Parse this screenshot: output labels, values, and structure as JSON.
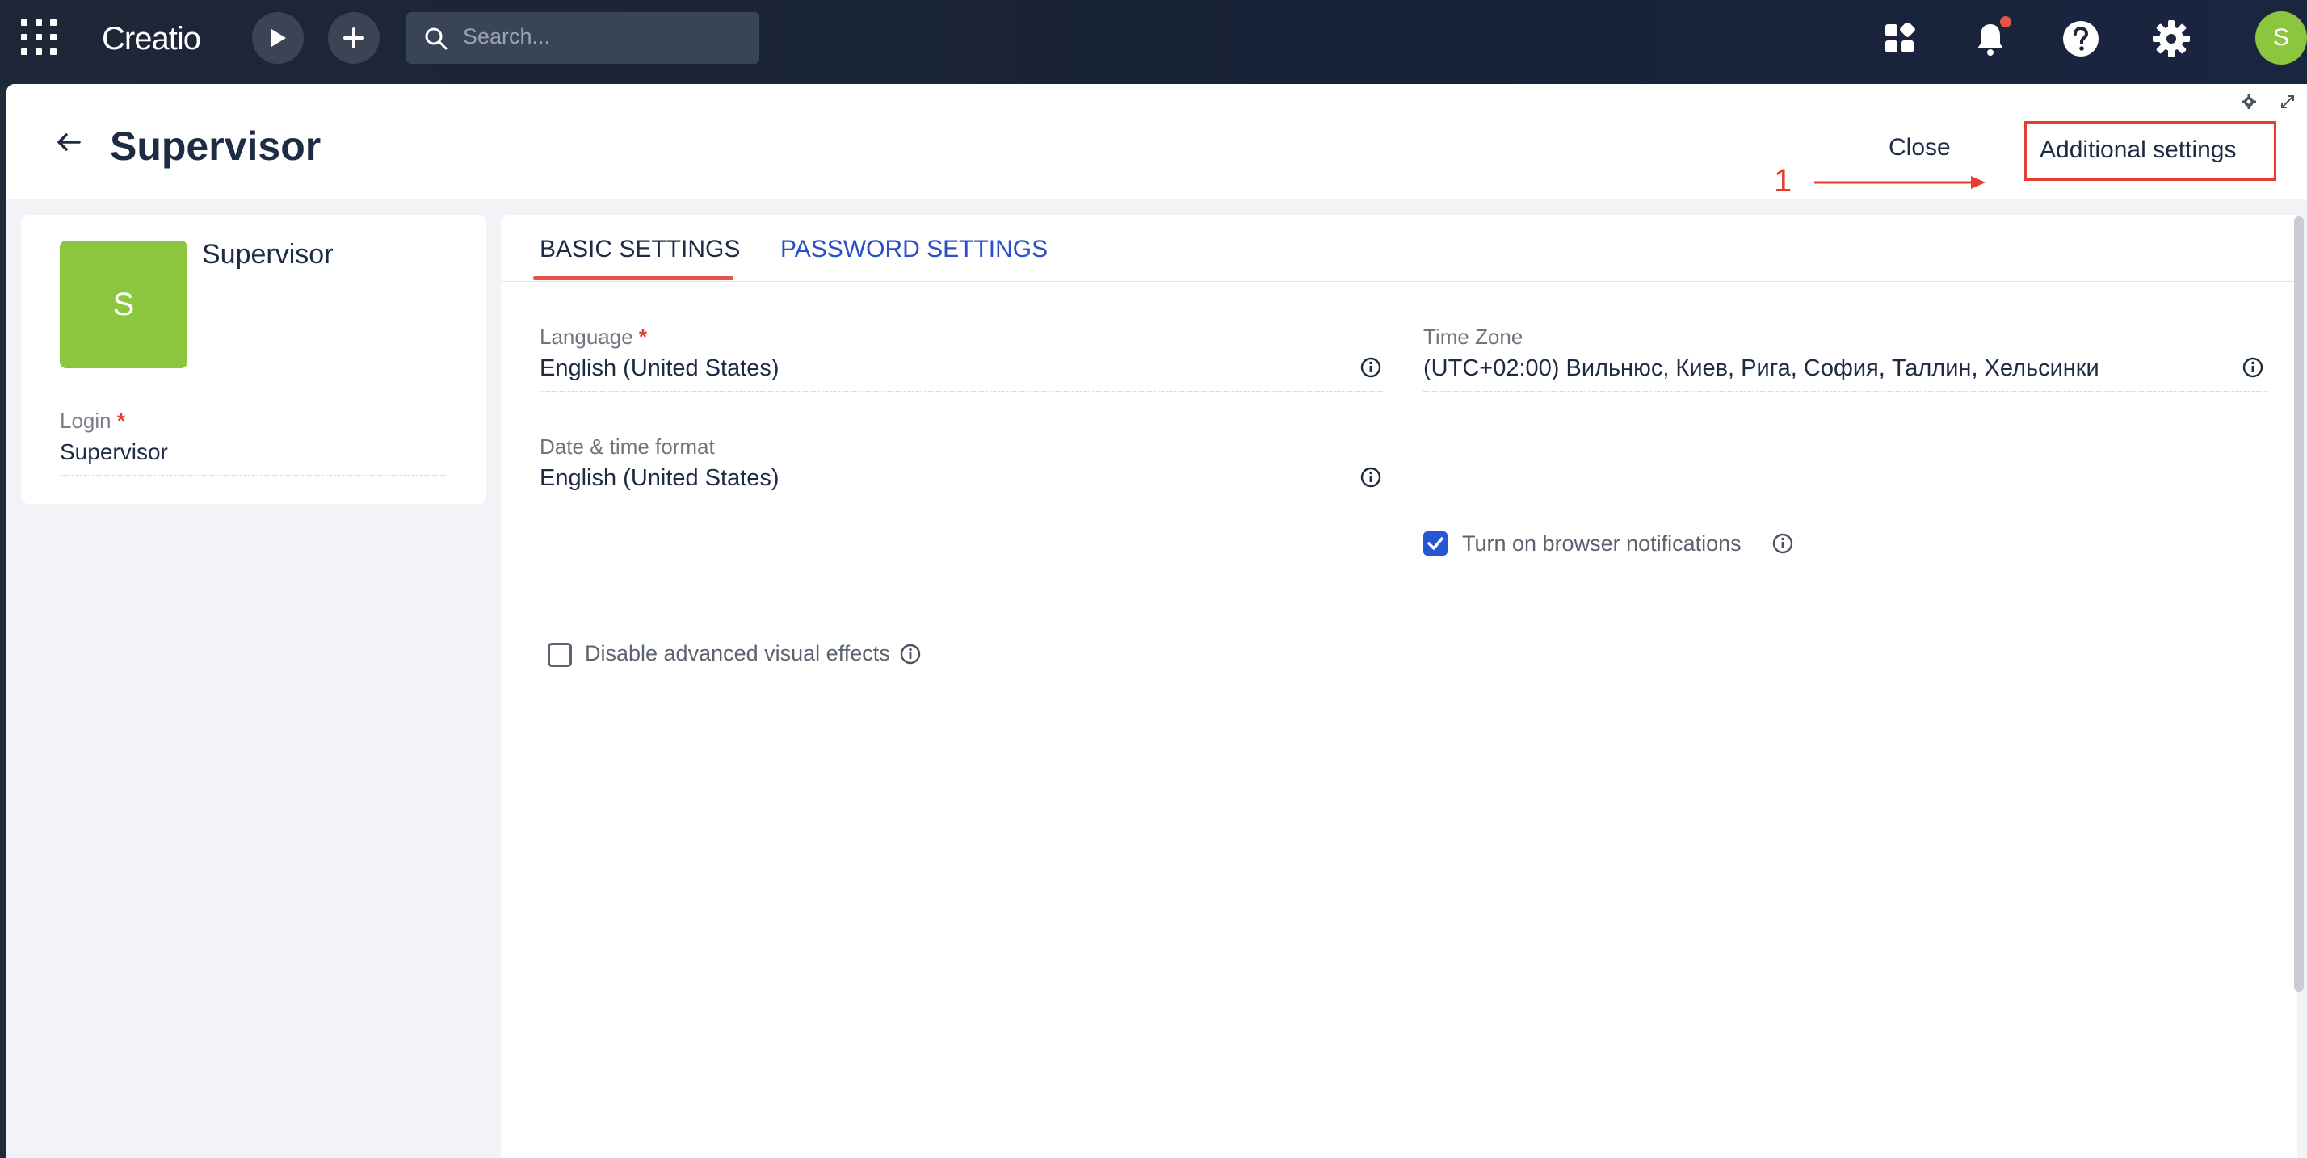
{
  "topbar": {
    "logo": "Creatio",
    "search_placeholder": "Search..."
  },
  "header": {
    "title": "Supervisor",
    "close_label": "Close",
    "additional_settings_label": "Additional settings",
    "annotation_number": "1"
  },
  "user": {
    "avatar_letter": "S",
    "name": "Supervisor",
    "login_label": "Login",
    "login_value": "Supervisor"
  },
  "tabs": [
    {
      "label": "BASIC SETTINGS",
      "active": true
    },
    {
      "label": "PASSWORD SETTINGS",
      "active": false
    }
  ],
  "basic": {
    "language_label": "Language",
    "language_value": "English (United States)",
    "timezone_label": "Time Zone",
    "timezone_value": "(UTC+02:00) Вильнюс, Киев, Рига, София, Таллин, Хельсинки",
    "datetime_label": "Date & time format",
    "datetime_value": "English (United States)",
    "browser_notifications_label": "Turn on browser notifications",
    "browser_notifications_checked": true,
    "disable_effects_label": "Disable advanced visual effects",
    "disable_effects_checked": false
  },
  "colors": {
    "accent": "#e5534b",
    "avatar": "#8cc63f",
    "link": "#2b4fc6",
    "checkbox": "#2456d6"
  },
  "required_marker": "*"
}
